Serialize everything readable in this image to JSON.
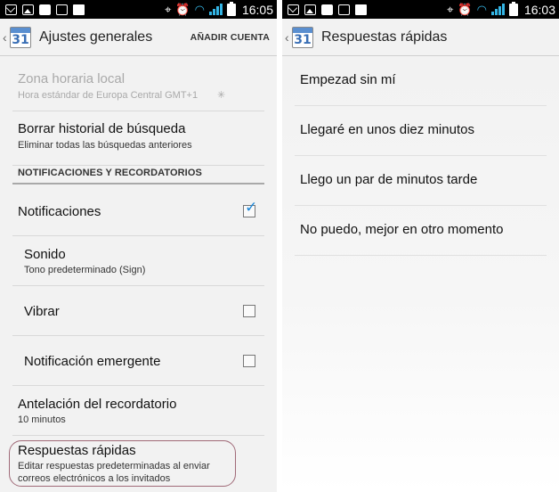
{
  "left": {
    "status": {
      "time": "16:05"
    },
    "actionbar": {
      "title": "Ajustes generales",
      "action": "AÑADIR CUENTA",
      "calendar_day": "31"
    },
    "items": {
      "timezone": {
        "title": "Zona horaria local",
        "summary": "Hora estándar de Europa Central  GMT+1"
      },
      "clear_history": {
        "title": "Borrar historial de búsqueda",
        "summary": "Eliminar todas las búsquedas anteriores"
      },
      "section_header": "NOTIFICACIONES Y RECORDATORIOS",
      "notifications": {
        "title": "Notificaciones",
        "checked": true
      },
      "sound": {
        "title": "Sonido",
        "summary": "Tono predeterminado (Sign)"
      },
      "vibrate": {
        "title": "Vibrar",
        "checked": false
      },
      "popup": {
        "title": "Notificación emergente",
        "checked": false
      },
      "reminder": {
        "title": "Antelación del recordatorio",
        "summary": "10 minutos"
      },
      "quick_responses": {
        "title": "Respuestas rápidas",
        "summary_line1": "Editar respuestas predeterminadas al enviar",
        "summary_line2": "correos electrónicos a los invitados"
      }
    }
  },
  "right": {
    "status": {
      "time": "16:03"
    },
    "actionbar": {
      "title": "Respuestas rápidas",
      "calendar_day": "31"
    },
    "responses": [
      "Empezad sin mí",
      "Llegaré en unos diez minutos",
      "Llego un par de minutos tarde",
      "No puedo, mejor en otro momento"
    ]
  },
  "colors": {
    "accent": "#34b5e5",
    "check": "#1e88d8",
    "highlight_oval": "#a06a78"
  },
  "icons": {
    "status_bar": [
      "mail-icon",
      "image-icon",
      "shield-icon",
      "check-icon",
      "bag-icon",
      "gps-icon",
      "alarm-icon",
      "wifi-icon",
      "signal-icon",
      "battery-icon"
    ],
    "app": "calendar-icon"
  }
}
